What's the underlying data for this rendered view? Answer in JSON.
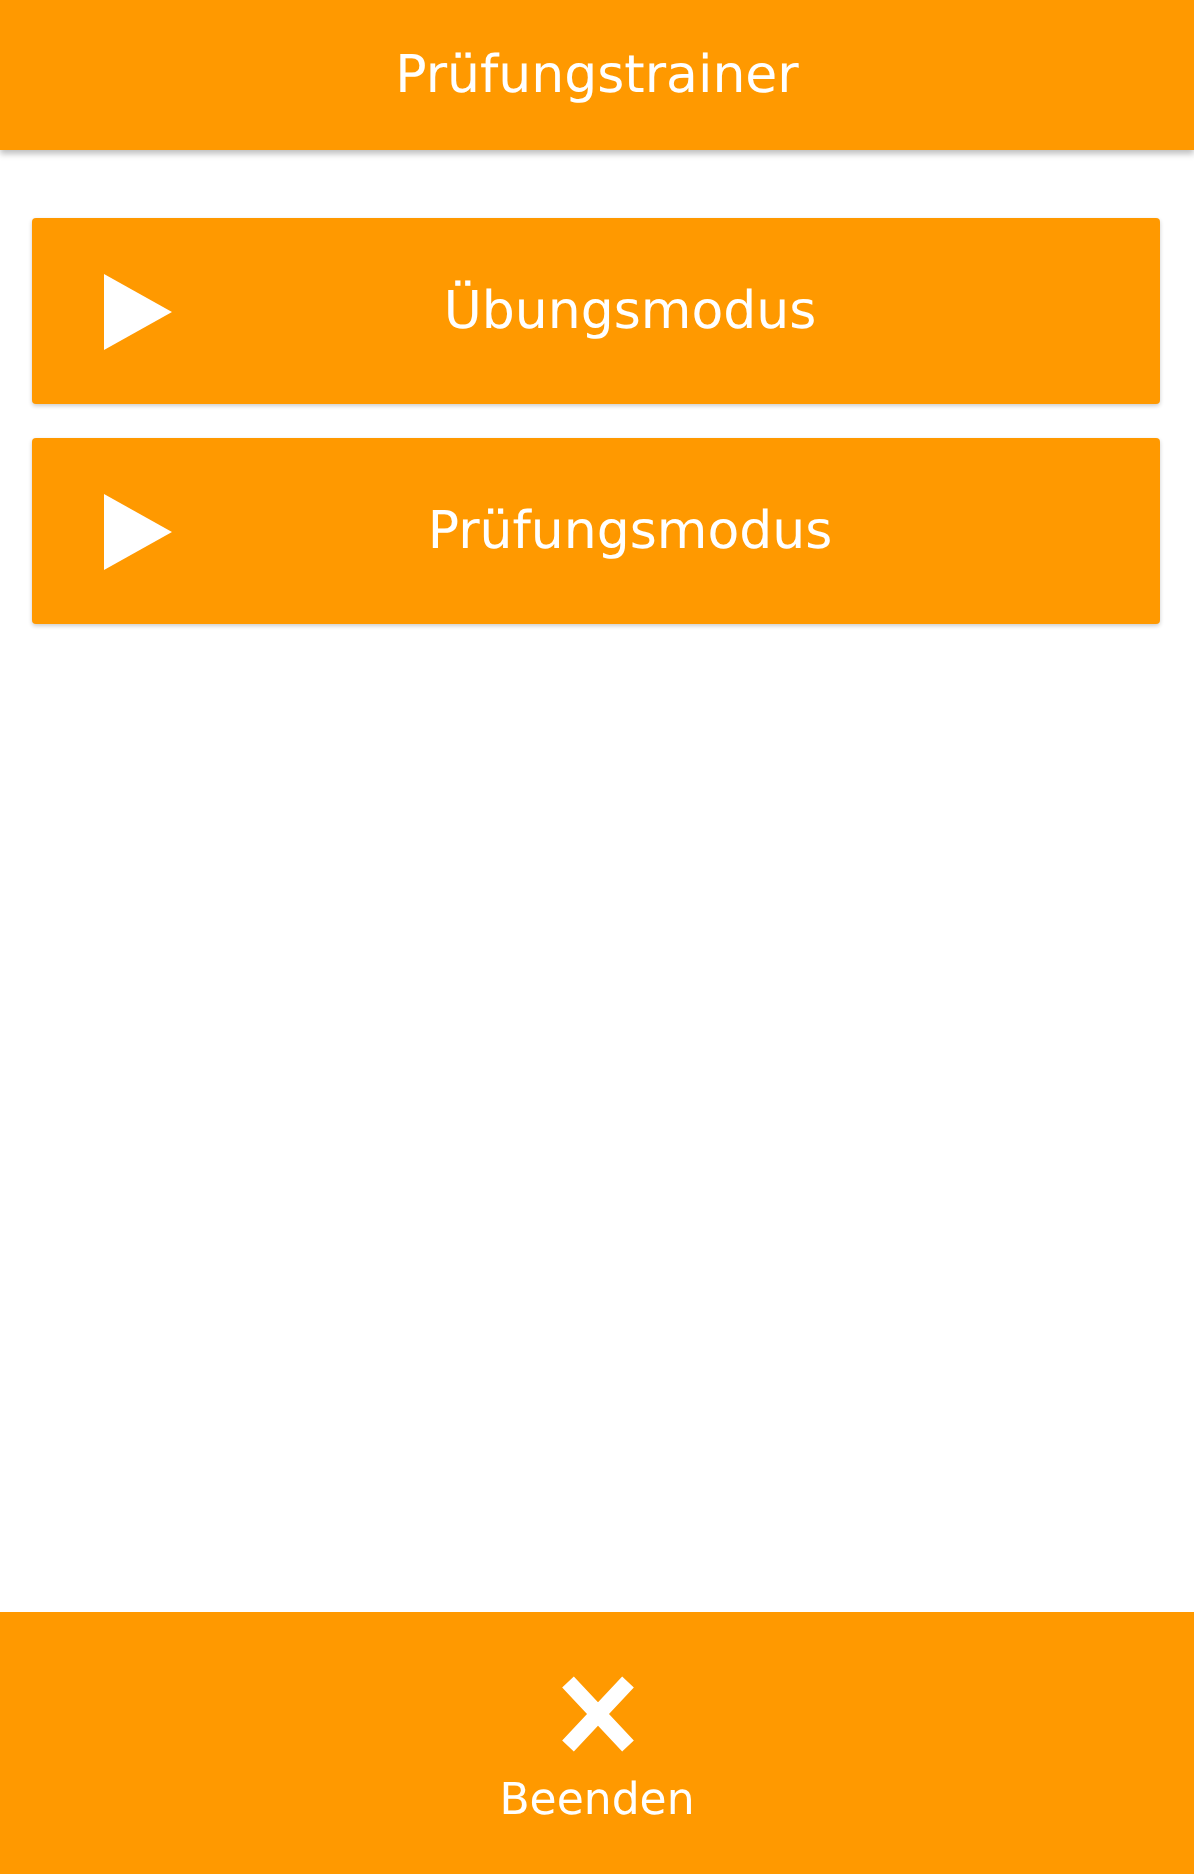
{
  "header": {
    "title": "Prüfungstrainer"
  },
  "menu": [
    {
      "label": "Übungsmodus"
    },
    {
      "label": "Prüfungsmodus"
    }
  ],
  "bottom_bar": {
    "label": "Beenden"
  }
}
